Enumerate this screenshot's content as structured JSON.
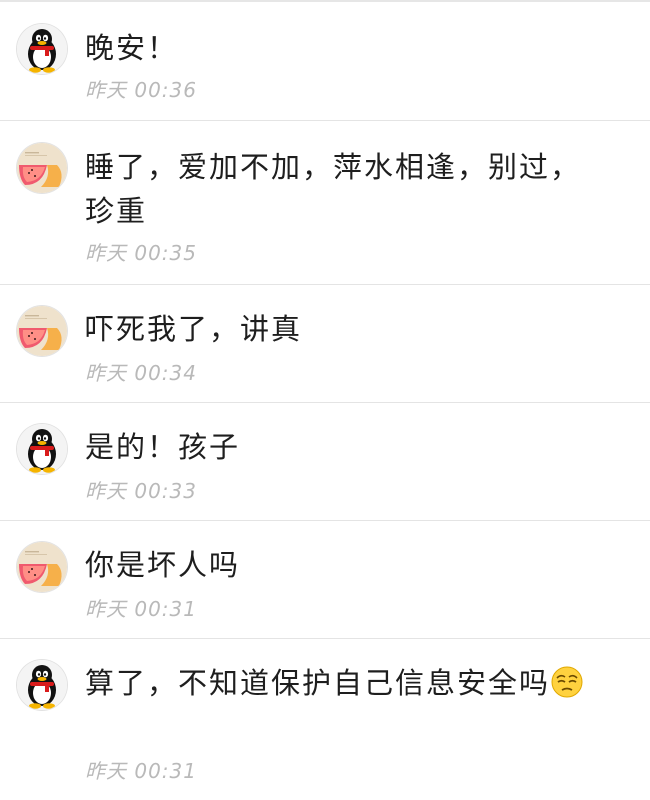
{
  "messages": [
    {
      "avatar": "qq-penguin-avatar",
      "text": "晚安！",
      "time": "昨天 00:36"
    },
    {
      "avatar": "watermelon-avatar",
      "text": "睡了，爱加不加，萍水相逢，别过，珍重",
      "time": "昨天 00:35"
    },
    {
      "avatar": "watermelon-avatar",
      "text": "吓死我了，讲真",
      "time": "昨天 00:34"
    },
    {
      "avatar": "qq-penguin-avatar",
      "text": "是的！孩子",
      "time": "昨天 00:33"
    },
    {
      "avatar": "watermelon-avatar",
      "text": "你是坏人吗",
      "time": "昨天 00:31"
    },
    {
      "avatar": "qq-penguin-avatar",
      "text": "算了，不知道保护自己信息安全吗",
      "emoji": "tired-face-emoji",
      "time": "昨天 00:31"
    }
  ]
}
